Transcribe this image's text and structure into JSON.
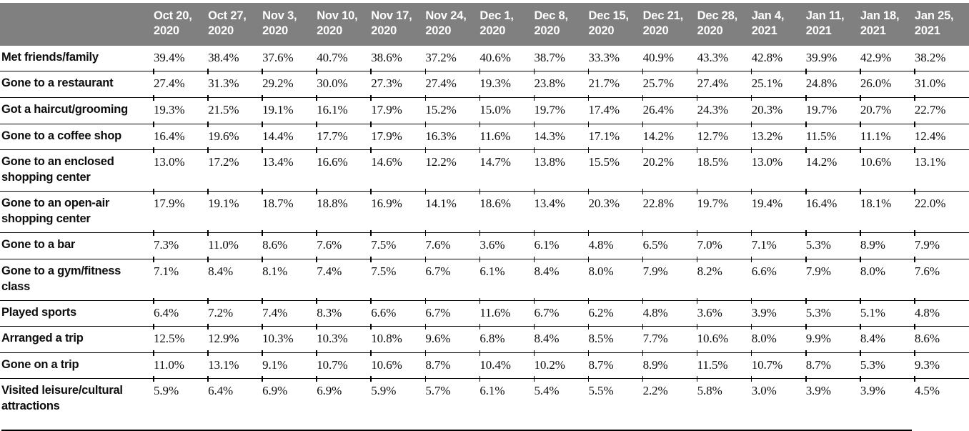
{
  "table": {
    "row_header_label": "",
    "columns": [
      {
        "date": "Oct 20,",
        "year": "2020"
      },
      {
        "date": "Oct 27,",
        "year": "2020"
      },
      {
        "date": "Nov 3,",
        "year": "2020"
      },
      {
        "date": "Nov 10,",
        "year": "2020"
      },
      {
        "date": "Nov 17,",
        "year": "2020"
      },
      {
        "date": "Nov 24,",
        "year": "2020"
      },
      {
        "date": "Dec 1,",
        "year": "2020"
      },
      {
        "date": "Dec 8,",
        "year": "2020"
      },
      {
        "date": "Dec 15,",
        "year": "2020"
      },
      {
        "date": "Dec 21,",
        "year": "2020"
      },
      {
        "date": "Dec 28,",
        "year": "2020"
      },
      {
        "date": "Jan 4,",
        "year": "2021"
      },
      {
        "date": "Jan 11,",
        "year": "2021"
      },
      {
        "date": "Jan 18,",
        "year": "2021"
      },
      {
        "date": "Jan 25,",
        "year": "2021"
      }
    ],
    "rows": [
      {
        "label": "Met friends/family",
        "values": [
          "39.4%",
          "38.4%",
          "37.6%",
          "40.7%",
          "38.6%",
          "37.2%",
          "40.6%",
          "38.7%",
          "33.3%",
          "40.9%",
          "43.3%",
          "42.8%",
          "39.9%",
          "42.9%",
          "38.2%"
        ]
      },
      {
        "label": "Gone to a restaurant",
        "values": [
          "27.4%",
          "31.3%",
          "29.2%",
          "30.0%",
          "27.3%",
          "27.4%",
          "19.3%",
          "23.8%",
          "21.7%",
          "25.7%",
          "27.4%",
          "25.1%",
          "24.8%",
          "26.0%",
          "31.0%"
        ]
      },
      {
        "label": "Got a haircut/grooming",
        "values": [
          "19.3%",
          "21.5%",
          "19.1%",
          "16.1%",
          "17.9%",
          "15.2%",
          "15.0%",
          "19.7%",
          "17.4%",
          "26.4%",
          "24.3%",
          "20.3%",
          "19.7%",
          "20.7%",
          "22.7%"
        ]
      },
      {
        "label": "Gone to a coffee shop",
        "values": [
          "16.4%",
          "19.6%",
          "14.4%",
          "17.7%",
          "17.9%",
          "16.3%",
          "11.6%",
          "14.3%",
          "17.1%",
          "14.2%",
          "12.7%",
          "13.2%",
          "11.5%",
          "11.1%",
          "12.4%"
        ]
      },
      {
        "label": "Gone to an enclosed shopping center",
        "values": [
          "13.0%",
          "17.2%",
          "13.4%",
          "16.6%",
          "14.6%",
          "12.2%",
          "14.7%",
          "13.8%",
          "15.5%",
          "20.2%",
          "18.5%",
          "13.0%",
          "14.2%",
          "10.6%",
          "13.1%"
        ]
      },
      {
        "label": "Gone to an open-air shopping center",
        "values": [
          "17.9%",
          "19.1%",
          "18.7%",
          "18.8%",
          "16.9%",
          "14.1%",
          "18.6%",
          "13.4%",
          "20.3%",
          "22.8%",
          "19.7%",
          "19.4%",
          "16.4%",
          "18.1%",
          "22.0%"
        ]
      },
      {
        "label": "Gone to a bar",
        "values": [
          "7.3%",
          "11.0%",
          "8.6%",
          "7.6%",
          "7.5%",
          "7.6%",
          "3.6%",
          "6.1%",
          "4.8%",
          "6.5%",
          "7.0%",
          "7.1%",
          "5.3%",
          "8.9%",
          "7.9%"
        ]
      },
      {
        "label": "Gone to a gym/fitness class",
        "values": [
          "7.1%",
          "8.4%",
          "8.1%",
          "7.4%",
          "7.5%",
          "6.7%",
          "6.1%",
          "8.4%",
          "8.0%",
          "7.9%",
          "8.2%",
          "6.6%",
          "7.9%",
          "8.0%",
          "7.6%"
        ]
      },
      {
        "label": "Played sports",
        "values": [
          "6.4%",
          "7.2%",
          "7.4%",
          "8.3%",
          "6.6%",
          "6.7%",
          "11.6%",
          "6.7%",
          "6.2%",
          "4.8%",
          "3.6%",
          "3.9%",
          "5.3%",
          "5.1%",
          "4.8%"
        ]
      },
      {
        "label": "Arranged a trip",
        "values": [
          "12.5%",
          "12.9%",
          "10.3%",
          "10.3%",
          "10.8%",
          "9.6%",
          "6.8%",
          "8.4%",
          "8.5%",
          "7.7%",
          "10.6%",
          "8.0%",
          "9.9%",
          "8.4%",
          "8.6%"
        ]
      },
      {
        "label": "Gone on a trip",
        "values": [
          "11.0%",
          "13.1%",
          "9.1%",
          "10.7%",
          "10.6%",
          "8.7%",
          "10.4%",
          "10.2%",
          "8.7%",
          "8.9%",
          "11.5%",
          "10.7%",
          "8.7%",
          "5.3%",
          "9.3%"
        ]
      },
      {
        "label": "Visited leisure/cultural attractions",
        "values": [
          "5.9%",
          "6.4%",
          "6.9%",
          "6.9%",
          "5.9%",
          "5.7%",
          "6.1%",
          "5.4%",
          "5.5%",
          "2.2%",
          "5.8%",
          "3.0%",
          "3.9%",
          "3.9%",
          "4.5%"
        ]
      }
    ]
  },
  "chart_data": {
    "type": "table",
    "title": "",
    "xlabel": "",
    "ylabel": "",
    "categories": [
      "Oct 20, 2020",
      "Oct 27, 2020",
      "Nov 3, 2020",
      "Nov 10, 2020",
      "Nov 17, 2020",
      "Nov 24, 2020",
      "Dec 1, 2020",
      "Dec 8, 2020",
      "Dec 15, 2020",
      "Dec 21, 2020",
      "Dec 28, 2020",
      "Jan 4, 2021",
      "Jan 11, 2021",
      "Jan 18, 2021",
      "Jan 25, 2021"
    ],
    "series": [
      {
        "name": "Met friends/family",
        "values": [
          39.4,
          38.4,
          37.6,
          40.7,
          38.6,
          37.2,
          40.6,
          38.7,
          33.3,
          40.9,
          43.3,
          42.8,
          39.9,
          42.9,
          38.2
        ]
      },
      {
        "name": "Gone to a restaurant",
        "values": [
          27.4,
          31.3,
          29.2,
          30.0,
          27.3,
          27.4,
          19.3,
          23.8,
          21.7,
          25.7,
          27.4,
          25.1,
          24.8,
          26.0,
          31.0
        ]
      },
      {
        "name": "Got a haircut/grooming",
        "values": [
          19.3,
          21.5,
          19.1,
          16.1,
          17.9,
          15.2,
          15.0,
          19.7,
          17.4,
          26.4,
          24.3,
          20.3,
          19.7,
          20.7,
          22.7
        ]
      },
      {
        "name": "Gone to a coffee shop",
        "values": [
          16.4,
          19.6,
          14.4,
          17.7,
          17.9,
          16.3,
          11.6,
          14.3,
          17.1,
          14.2,
          12.7,
          13.2,
          11.5,
          11.1,
          12.4
        ]
      },
      {
        "name": "Gone to an enclosed shopping center",
        "values": [
          13.0,
          17.2,
          13.4,
          16.6,
          14.6,
          12.2,
          14.7,
          13.8,
          15.5,
          20.2,
          18.5,
          13.0,
          14.2,
          10.6,
          13.1
        ]
      },
      {
        "name": "Gone to an open-air shopping center",
        "values": [
          17.9,
          19.1,
          18.7,
          18.8,
          16.9,
          14.1,
          18.6,
          13.4,
          20.3,
          22.8,
          19.7,
          19.4,
          16.4,
          18.1,
          22.0
        ]
      },
      {
        "name": "Gone to a bar",
        "values": [
          7.3,
          11.0,
          8.6,
          7.6,
          7.5,
          7.6,
          3.6,
          6.1,
          4.8,
          6.5,
          7.0,
          7.1,
          5.3,
          8.9,
          7.9
        ]
      },
      {
        "name": "Gone to a gym/fitness class",
        "values": [
          7.1,
          8.4,
          8.1,
          7.4,
          7.5,
          6.7,
          6.1,
          8.4,
          8.0,
          7.9,
          8.2,
          6.6,
          7.9,
          8.0,
          7.6
        ]
      },
      {
        "name": "Played sports",
        "values": [
          6.4,
          7.2,
          7.4,
          8.3,
          6.6,
          6.7,
          11.6,
          6.7,
          6.2,
          4.8,
          3.6,
          3.9,
          5.3,
          5.1,
          4.8
        ]
      },
      {
        "name": "Arranged a trip",
        "values": [
          12.5,
          12.9,
          10.3,
          10.3,
          10.8,
          9.6,
          6.8,
          8.4,
          8.5,
          7.7,
          10.6,
          8.0,
          9.9,
          8.4,
          8.6
        ]
      },
      {
        "name": "Gone on a trip",
        "values": [
          11.0,
          13.1,
          9.1,
          10.7,
          10.6,
          8.7,
          10.4,
          10.2,
          8.7,
          8.9,
          11.5,
          10.7,
          8.7,
          5.3,
          9.3
        ]
      },
      {
        "name": "Visited leisure/cultural attractions",
        "values": [
          5.9,
          6.4,
          6.9,
          6.9,
          5.9,
          5.7,
          6.1,
          5.4,
          5.5,
          2.2,
          5.8,
          3.0,
          3.9,
          3.9,
          4.5
        ]
      }
    ],
    "unit": "percent",
    "grid": true,
    "legend_position": "none"
  },
  "style": {
    "header_background": "#808080",
    "header_text": "#ffffff",
    "rule_color": "#000000",
    "body_text": "#0d0d0d"
  }
}
